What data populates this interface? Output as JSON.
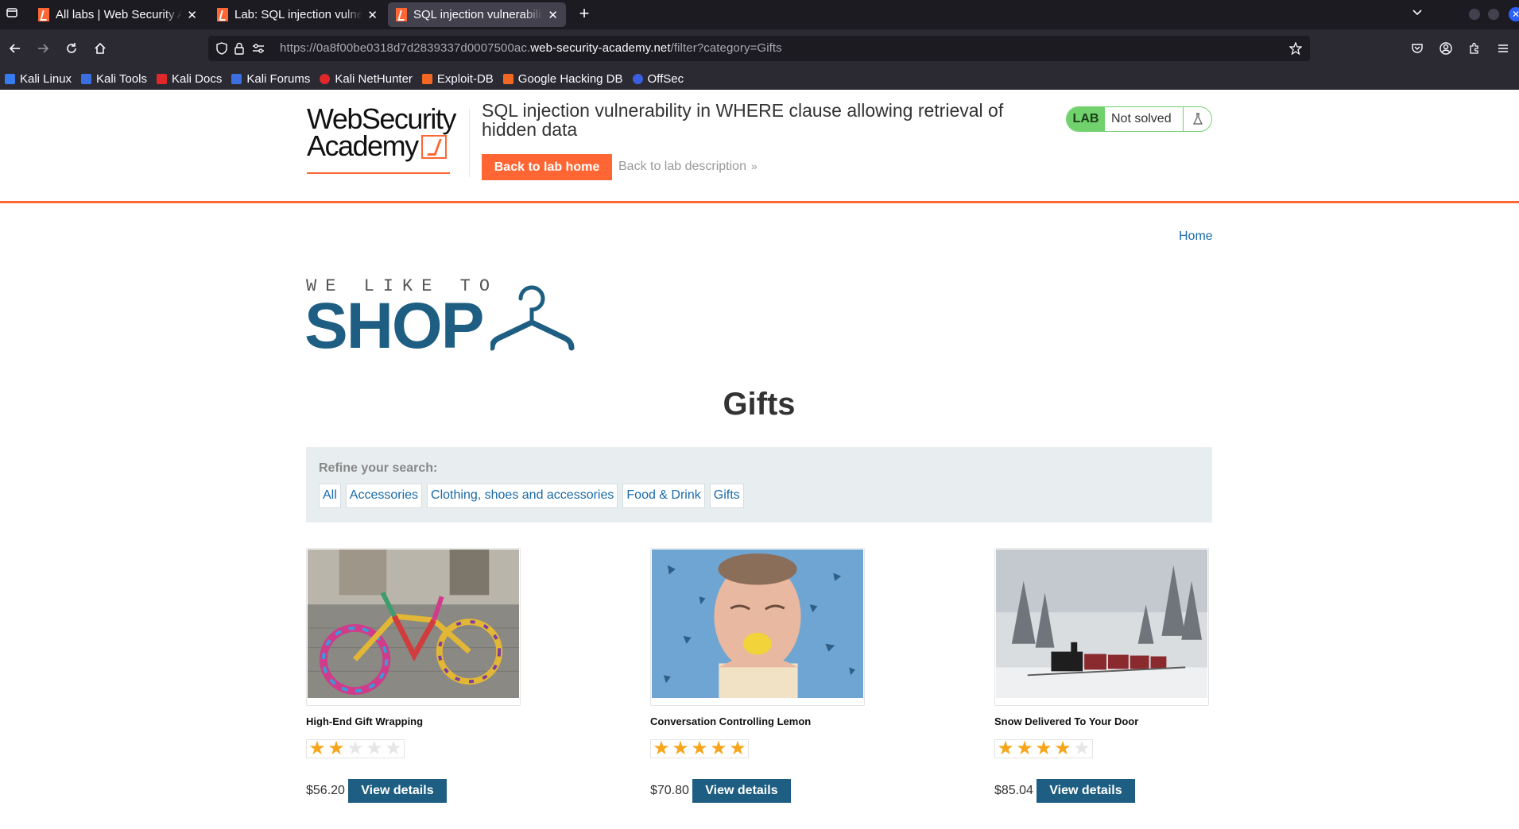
{
  "browser": {
    "tabs": [
      {
        "title": "All labs | Web Security Academy",
        "active": false
      },
      {
        "title": "Lab: SQL injection vulnerability",
        "active": false
      },
      {
        "title": "SQL injection vulnerability",
        "active": true
      }
    ],
    "url": {
      "prefix": "https://0a8f00be0318d7d2839337d0007500ac.",
      "domain": "web-security-academy.net",
      "path": "/filter?category=Gifts"
    },
    "bookmarks": [
      {
        "label": "Kali Linux",
        "color": "#367bf0"
      },
      {
        "label": "Kali Tools",
        "color": "#3b6fe0"
      },
      {
        "label": "Kali Docs",
        "color": "#e0282a"
      },
      {
        "label": "Kali Forums",
        "color": "#3b6fe0"
      },
      {
        "label": "Kali NetHunter",
        "color": "#e0282a"
      },
      {
        "label": "Exploit-DB",
        "color": "#f26822"
      },
      {
        "label": "Google Hacking DB",
        "color": "#f26822"
      },
      {
        "label": "OffSec",
        "color": "#3b5fe0"
      }
    ]
  },
  "academy": {
    "logo_line1": "WebSecurity",
    "logo_line2": "Academy",
    "lab_title": "SQL injection vulnerability in WHERE clause allowing retrieval of hidden data",
    "back_button": "Back to lab home",
    "desc_link": "Back to lab description",
    "status_badge": "LAB",
    "status_text": "Not solved"
  },
  "shop": {
    "home_link": "Home",
    "logo_small": "WE LIKE TO",
    "logo_big": "SHOP",
    "heading": "Gifts",
    "filters_label": "Refine your search:",
    "filters": [
      "All",
      "Accessories",
      "Clothing, shoes and accessories",
      "Food & Drink",
      "Gifts"
    ],
    "products": [
      {
        "name": "High-End Gift Wrapping",
        "rating": 2,
        "price": "$56.20",
        "button": "View details"
      },
      {
        "name": "Conversation Controlling Lemon",
        "rating": 5,
        "price": "$70.80",
        "button": "View details"
      },
      {
        "name": "Snow Delivered To Your Door",
        "rating": 4,
        "price": "$85.04",
        "button": "View details"
      }
    ]
  },
  "colors": {
    "accent_orange": "#ff6633",
    "shop_blue": "#1d5e82",
    "link_blue": "#1a6aa8",
    "status_green": "#70d16d",
    "star_gold": "#f7a51b"
  }
}
